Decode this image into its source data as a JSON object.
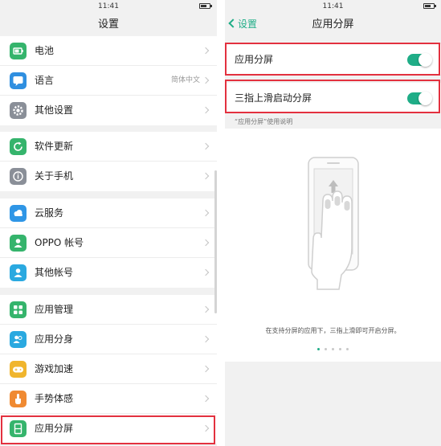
{
  "status": {
    "time": "11:41"
  },
  "left": {
    "title": "设置",
    "groups": [
      [
        {
          "label": "电池",
          "icon": "battery-icon",
          "color": "#35b46c"
        },
        {
          "label": "语言",
          "value": "简体中文",
          "icon": "language-icon",
          "color": "#2f8fe0"
        },
        {
          "label": "其他设置",
          "icon": "gear-icon",
          "color": "#8a8f98"
        }
      ],
      [
        {
          "label": "软件更新",
          "icon": "refresh-icon",
          "color": "#35b46c"
        },
        {
          "label": "关于手机",
          "icon": "info-icon",
          "color": "#8a8f98"
        }
      ],
      [
        {
          "label": "云服务",
          "icon": "cloud-icon",
          "color": "#2f96e6"
        },
        {
          "label": "OPPO 帐号",
          "icon": "person-icon",
          "color": "#35b46c"
        },
        {
          "label": "其他帐号",
          "icon": "person-icon",
          "color": "#2aa9e0"
        }
      ],
      [
        {
          "label": "应用管理",
          "icon": "apps-grid-icon",
          "color": "#35b46c"
        },
        {
          "label": "应用分身",
          "icon": "clone-icon",
          "color": "#2aa9e0"
        },
        {
          "label": "游戏加速",
          "icon": "gamepad-icon",
          "color": "#f0b52d"
        },
        {
          "label": "手势体感",
          "icon": "hand-icon",
          "color": "#f08a32"
        },
        {
          "label": "应用分屏",
          "icon": "split-screen-icon",
          "color": "#35b46c"
        }
      ]
    ]
  },
  "right": {
    "back_label": "设置",
    "title": "应用分屏",
    "toggles": [
      {
        "label": "应用分屏",
        "on": true
      },
      {
        "label": "三指上滑启动分屏",
        "on": true
      }
    ],
    "hint": "“应用分屏”使用说明",
    "caption": "在支持分屏的应用下，三指上滑即可开启分屏。",
    "page_dots": 5,
    "active_dot": 0
  },
  "colors": {
    "accent": "#1fad87",
    "highlight_border": "#e3313f"
  }
}
